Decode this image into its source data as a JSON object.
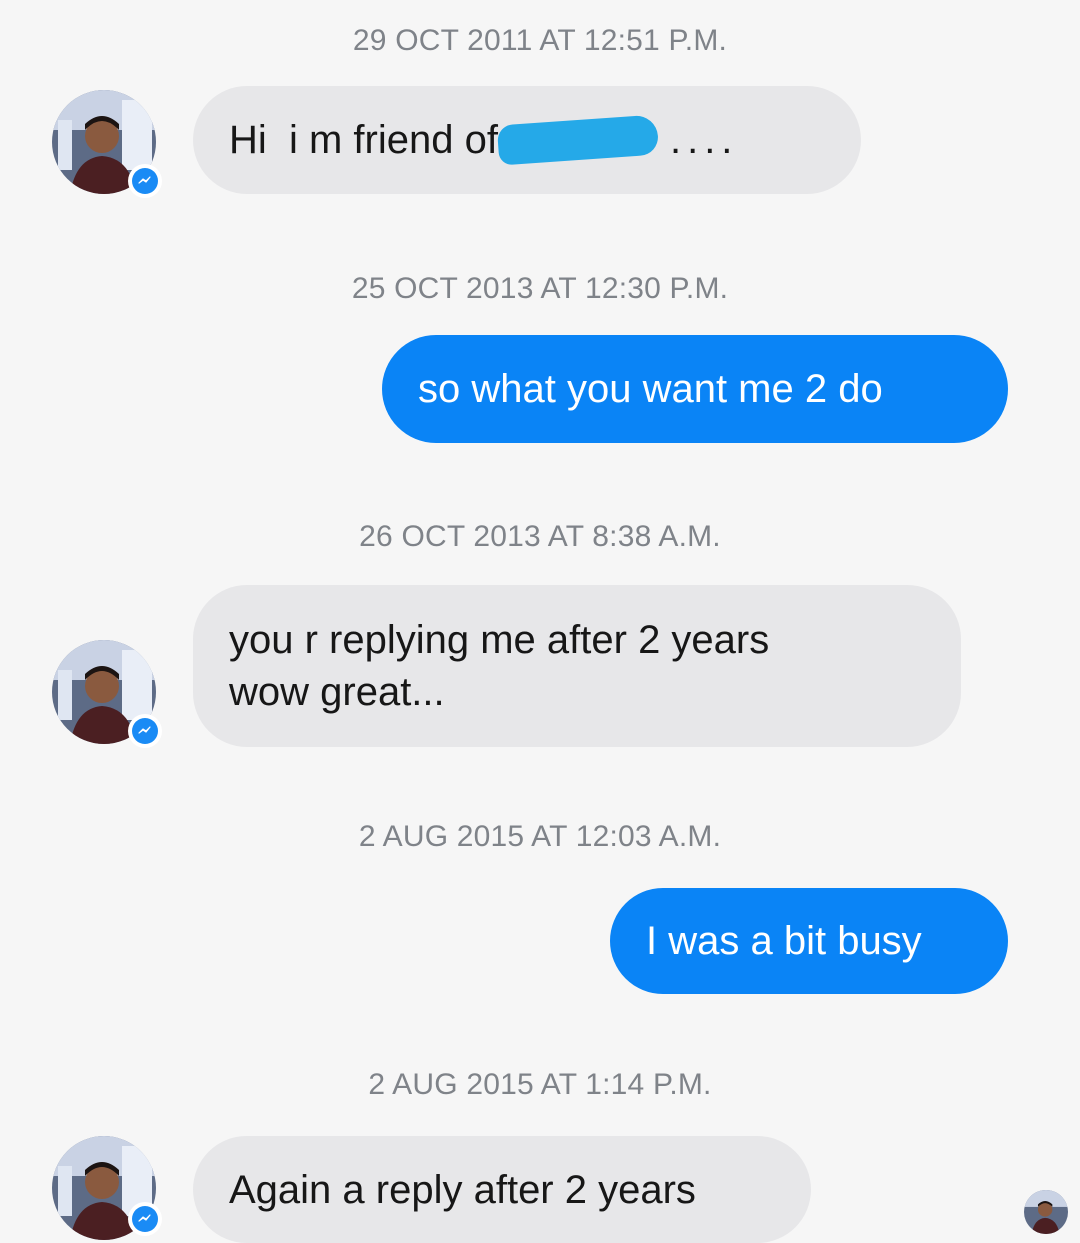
{
  "messages": [
    {
      "timestamp": "29 OCT 2011 AT 12:51 P.M.",
      "direction": "incoming",
      "text_before_redaction": "Hi  i m friend of",
      "text_after_redaction": "...."
    },
    {
      "timestamp": "25 OCT 2013 AT 12:30 P.M.",
      "direction": "outgoing",
      "text": "so what you want me 2 do"
    },
    {
      "timestamp": "26 OCT 2013 AT 8:38 A.M.",
      "direction": "incoming",
      "line1": "you r replying me after 2 years",
      "line2": "wow great..."
    },
    {
      "timestamp": "2 AUG 2015 AT 12:03 A.M.",
      "direction": "outgoing",
      "text": "I was a bit busy"
    },
    {
      "timestamp": "2 AUG 2015 AT 1:14 P.M.",
      "direction": "incoming",
      "text": "Again a reply after 2 years"
    }
  ],
  "colors": {
    "background": "#f6f6f6",
    "incoming_bubble": "#e7e7e9",
    "outgoing_bubble": "#0a84f6",
    "timestamp_text": "#7f8389",
    "messenger_badge": "#1a8bf5",
    "redaction_scribble": "#25a9e8"
  },
  "icons": {
    "contact_avatar": "avatar-icon",
    "messenger_badge": "messenger-badge-icon",
    "seen_indicator": "seen-avatar-icon"
  }
}
